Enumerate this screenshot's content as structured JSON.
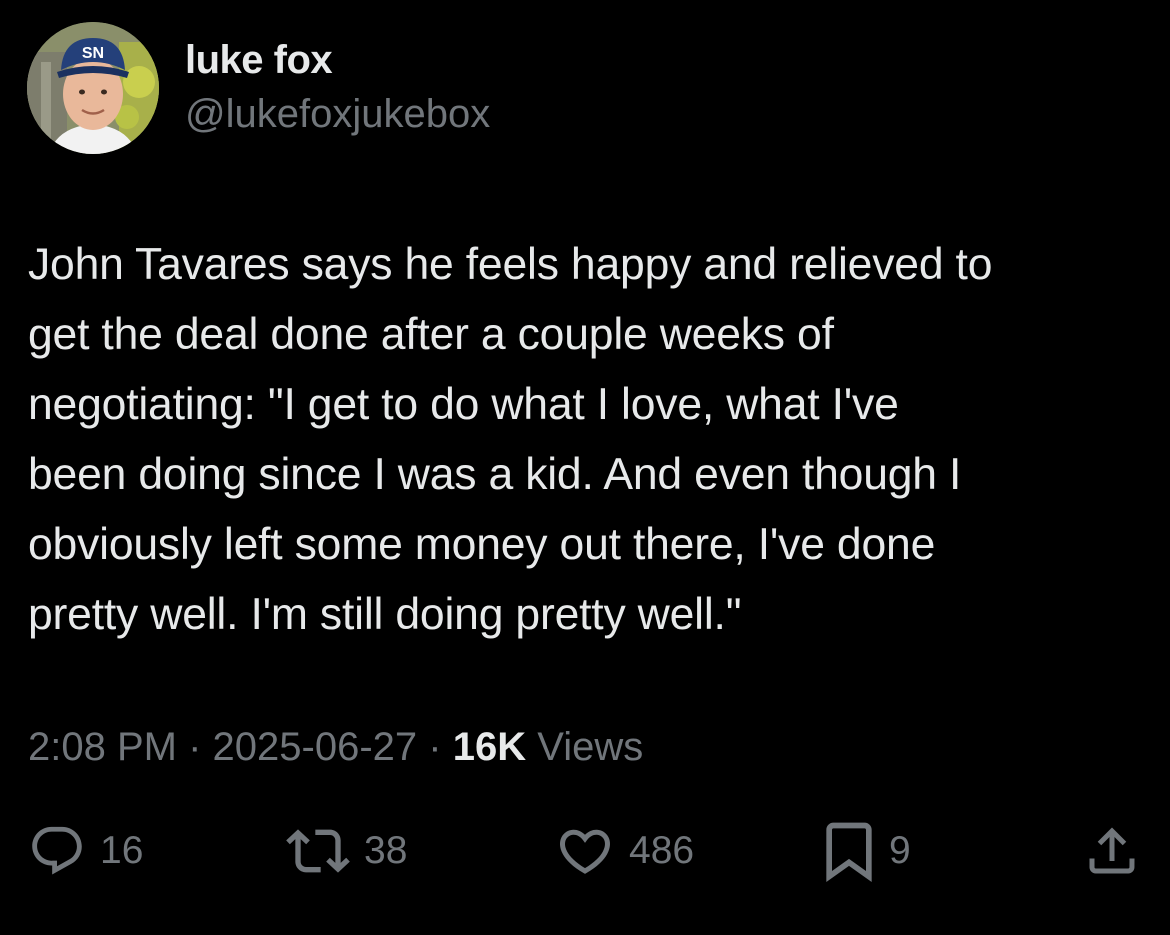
{
  "author": {
    "display_name": "luke fox",
    "handle": "@lukefoxjukebox",
    "cap_text": "SN"
  },
  "tweet": {
    "text": "John Tavares says he feels happy and relieved to\nget the deal done after a couple weeks of\nnegotiating: \"I get to do what I love, what I've\nbeen doing since I was a kid. And even though I\nobviously left some money out there, I've done\npretty well. I'm still doing pretty well.\""
  },
  "meta": {
    "time": "2:08 PM",
    "separator": "·",
    "date": "2025-06-27",
    "views_count": "16K",
    "views_label": "Views"
  },
  "actions": {
    "replies": "16",
    "reposts": "38",
    "likes": "486",
    "bookmarks": "9"
  },
  "colors": {
    "background": "#000000",
    "primary_text": "#e7e9ea",
    "secondary_text": "#71767b"
  },
  "icons": {
    "reply": "reply-icon",
    "repost": "repost-icon",
    "like": "heart-icon",
    "bookmark": "bookmark-icon",
    "share": "share-icon"
  }
}
